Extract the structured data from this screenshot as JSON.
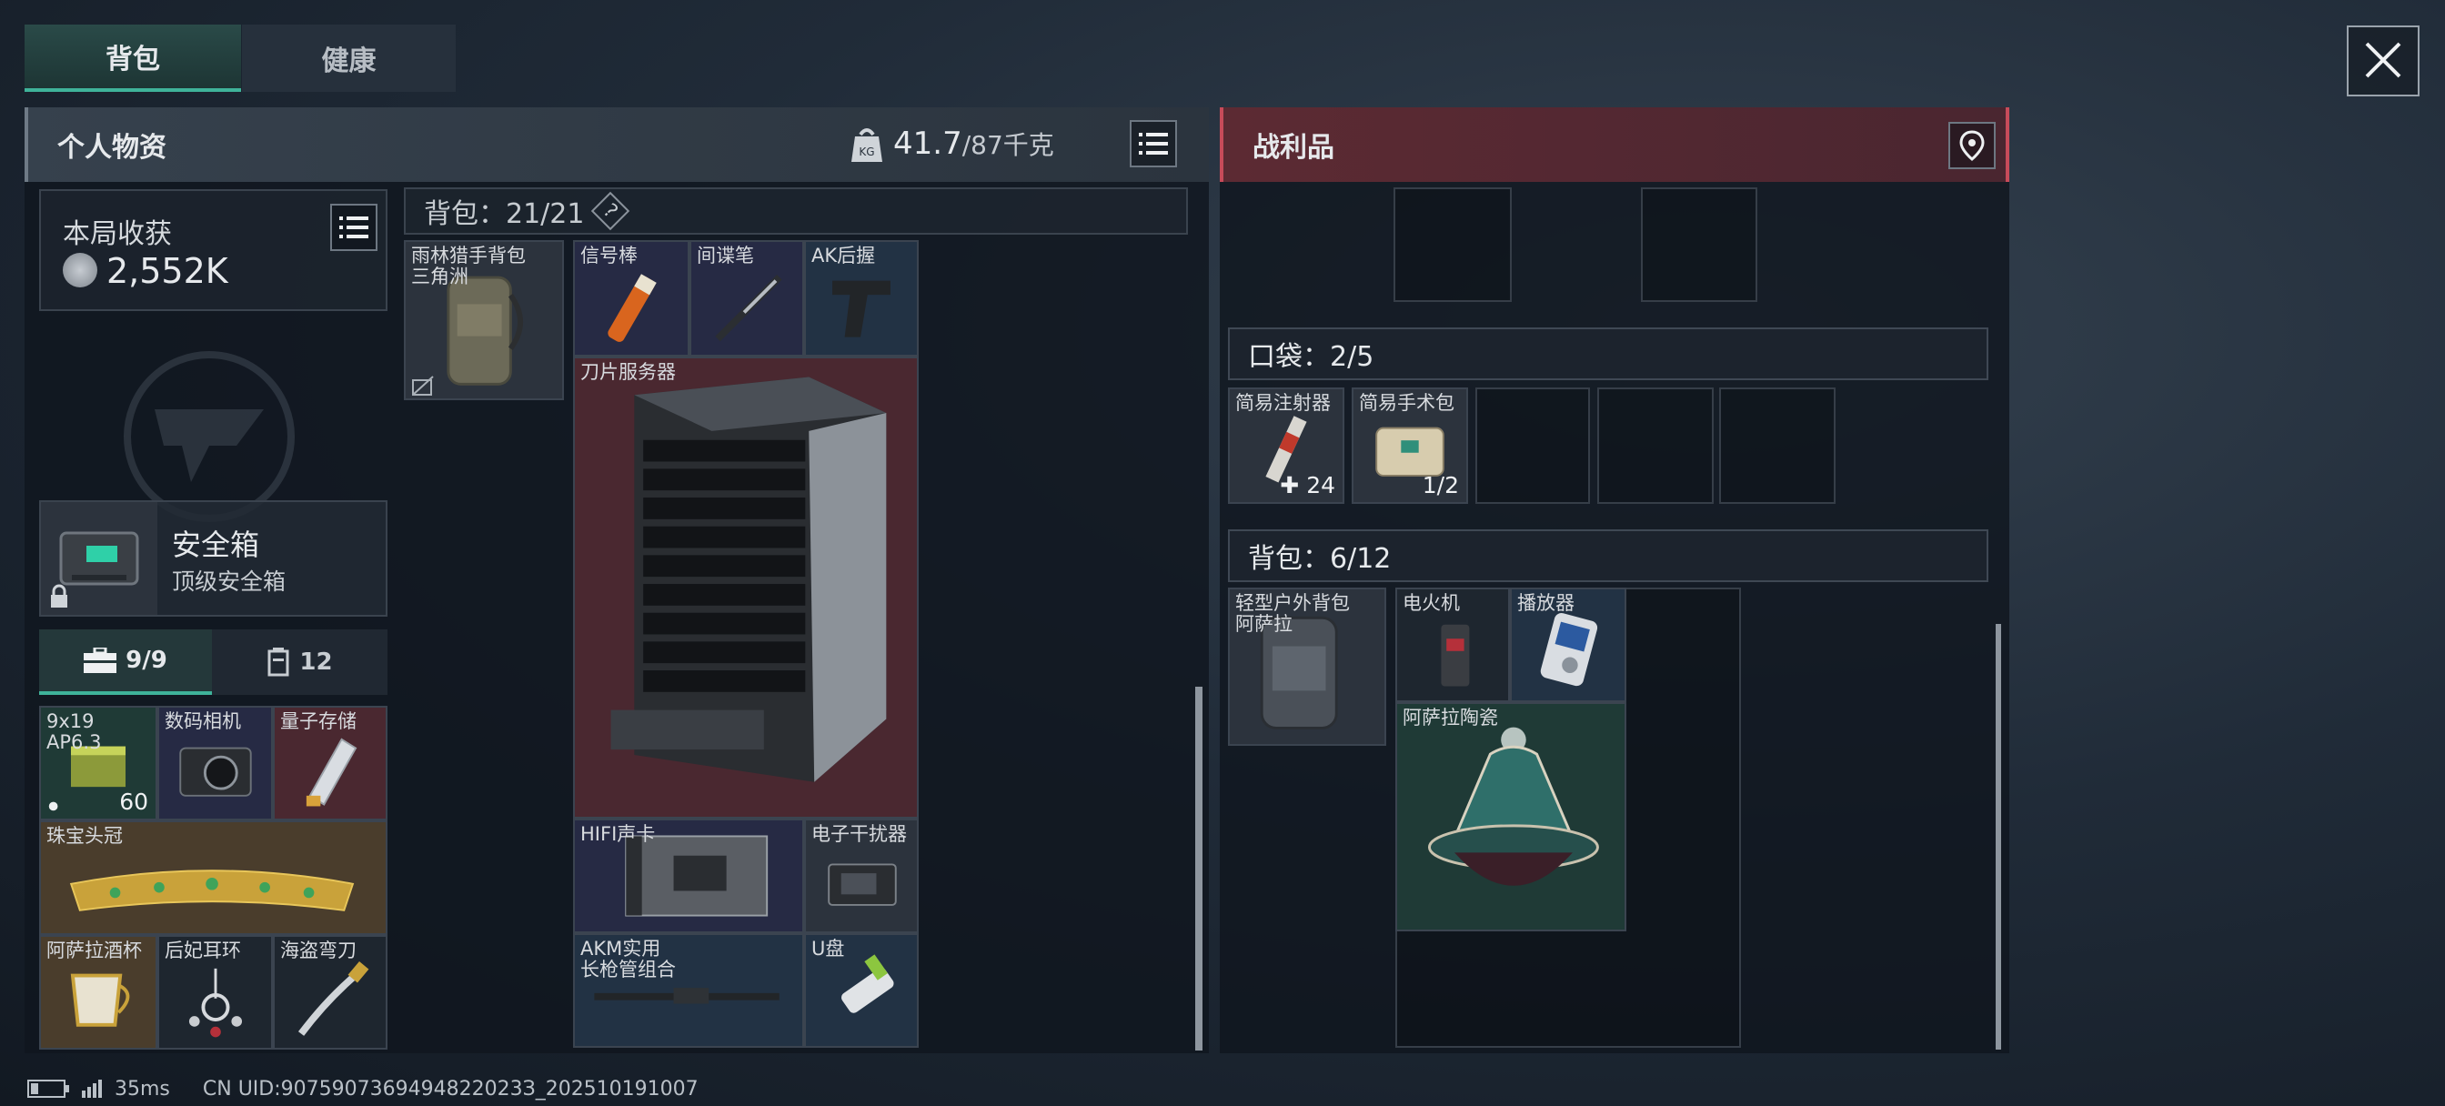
{
  "tabs": {
    "backpack": "背包",
    "health": "健康"
  },
  "left_panel": {
    "title": "个人物资",
    "weight_value": "41.7",
    "weight_max": "/87千克",
    "weight_icon_text": "KG",
    "session": {
      "label": "本局收获",
      "value": "2,552K"
    },
    "safe_box": {
      "name": "安全箱",
      "type": "顶级安全箱"
    },
    "safe_tabs": {
      "items": "9/9",
      "count": "12"
    },
    "safe_items": [
      {
        "label": "9x19\nAP6.3",
        "qty": "60"
      },
      {
        "label": "数码相机"
      },
      {
        "label": "量子存储"
      },
      {
        "label": "珠宝头冠"
      },
      {
        "label": "阿萨拉酒杯"
      },
      {
        "label": "后妃耳环"
      },
      {
        "label": "海盗弯刀"
      }
    ],
    "backpack": {
      "header": "背包：21/21",
      "help": "?",
      "bag_item": "雨林猎手背包\n三角洲",
      "items": [
        {
          "label": "信号棒"
        },
        {
          "label": "间谍笔"
        },
        {
          "label": "AK后握"
        },
        {
          "label": "刀片服务器"
        },
        {
          "label": "HIFI声卡"
        },
        {
          "label": "电子干扰器"
        },
        {
          "label": "AKM实用\n长枪管组合"
        },
        {
          "label": "U盘"
        }
      ]
    }
  },
  "right_panel": {
    "title": "战利品",
    "pocket": {
      "header": "口袋：2/5",
      "items": [
        {
          "label": "简易注射器",
          "qty": "24"
        },
        {
          "label": "简易手术包",
          "qty": "1/2"
        }
      ]
    },
    "backpack": {
      "header": "背包：6/12",
      "bag_item": "轻型户外背包\n阿萨拉",
      "items": [
        {
          "label": "电火机"
        },
        {
          "label": "播放器"
        },
        {
          "label": "阿萨拉陶瓷"
        }
      ]
    }
  },
  "status": {
    "ping": "35ms",
    "uid": "CN UID:9075907369494822023З_202510191007"
  },
  "colors": {
    "accent_tab": "#2f8f7a",
    "loot_header": "#5a2a33"
  }
}
